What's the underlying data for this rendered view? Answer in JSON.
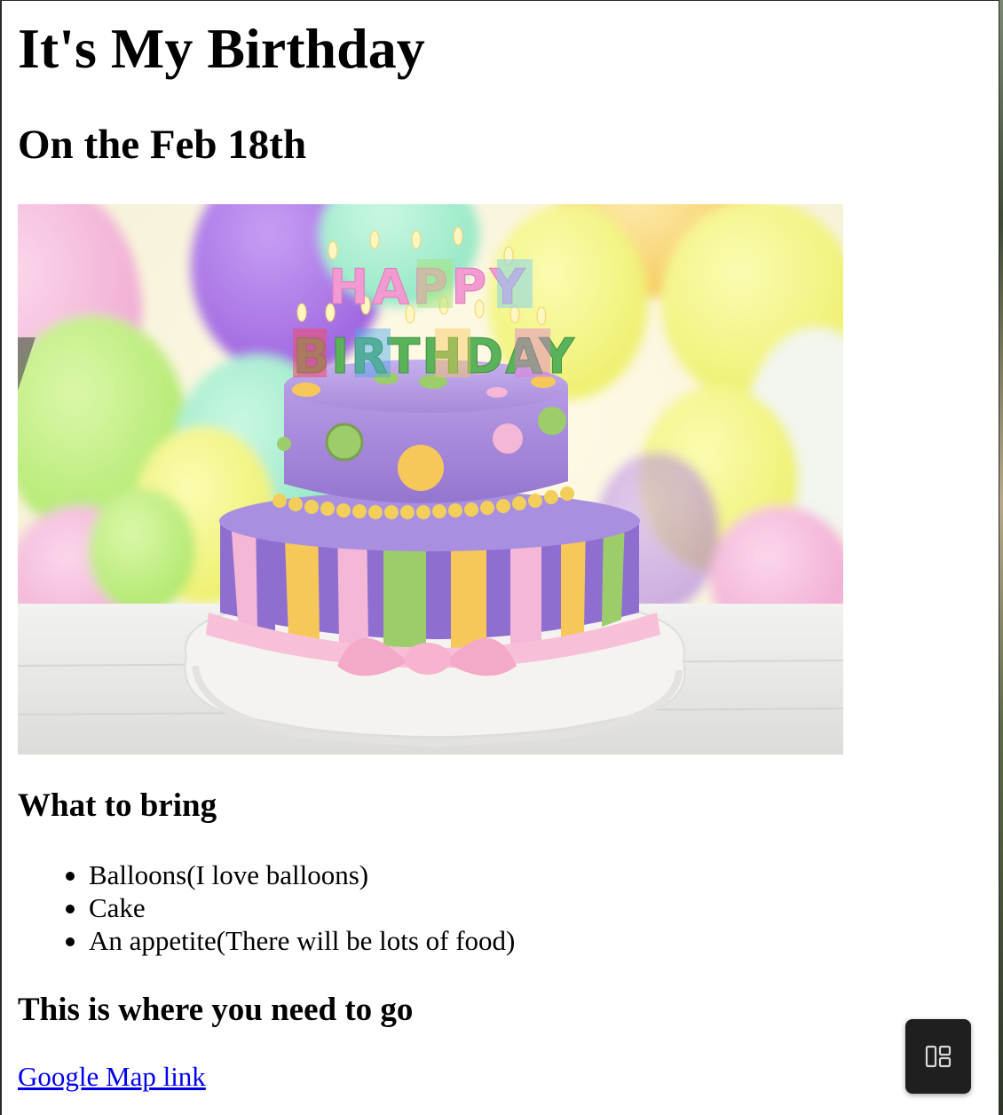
{
  "page": {
    "title": "It's My Birthday",
    "subtitle": "On the Feb 18th"
  },
  "image": {
    "alt": "Birthday cake with HAPPY BIRTHDAY candles",
    "candle_line1": "HAPPY",
    "candle_line2": "BIRTHDAY"
  },
  "bring": {
    "heading": "What to bring",
    "items": [
      "Balloons(I love balloons)",
      "Cake",
      "An appetite(There will be lots of food)"
    ]
  },
  "location": {
    "heading": "This is where you need to go",
    "link_label": "Google Map link"
  },
  "colors": {
    "link": "#0000ee",
    "floating_button": "#1f1f1f"
  },
  "icons": {
    "floating_button": "layout-panels-icon"
  }
}
